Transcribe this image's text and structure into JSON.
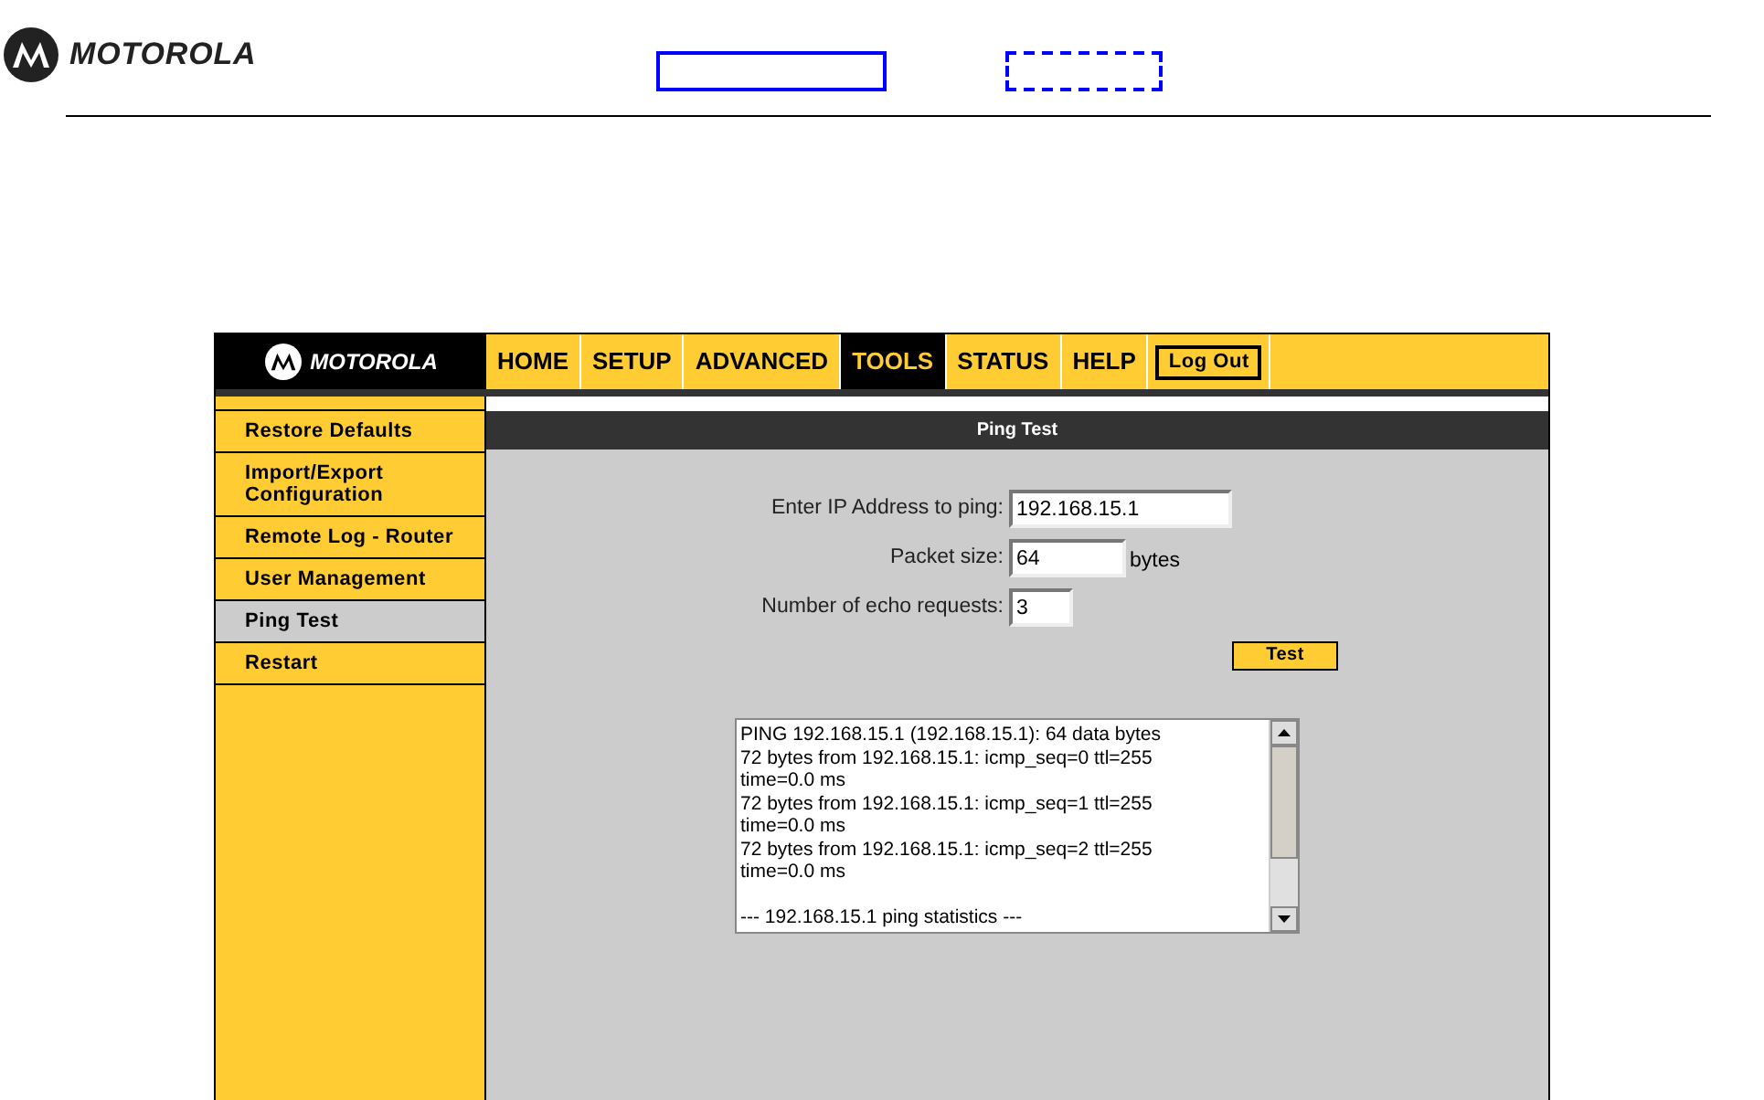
{
  "header": {
    "brand": "MOTOROLA"
  },
  "router_ui": {
    "brand": "MOTOROLA",
    "nav": [
      {
        "label": "HOME",
        "selected": false
      },
      {
        "label": "SETUP",
        "selected": false
      },
      {
        "label": "ADVANCED",
        "selected": false
      },
      {
        "label": "TOOLS",
        "selected": true
      },
      {
        "label": "STATUS",
        "selected": false
      },
      {
        "label": "HELP",
        "selected": false
      }
    ],
    "logout_button": "Log Out",
    "sidebar": [
      {
        "label": "Restore Defaults",
        "selected": false
      },
      {
        "label": "Import/Export Configuration",
        "selected": false
      },
      {
        "label": "Remote Log - Router",
        "selected": false
      },
      {
        "label": "User Management",
        "selected": false
      },
      {
        "label": "Ping Test",
        "selected": true
      },
      {
        "label": "Restart",
        "selected": false
      }
    ],
    "panel_title": "Ping Test",
    "fields": [
      {
        "label": "Enter IP Address to ping:",
        "value": "192.168.15.1"
      },
      {
        "label": "Packet size:",
        "value": "64",
        "unit": "bytes"
      },
      {
        "label": "Number of echo requests:",
        "value": "3"
      }
    ],
    "test_button": "Test",
    "output": "PING 192.168.15.1 (192.168.15.1): 64 data bytes\n72 bytes from 192.168.15.1: icmp_seq=0 ttl=255\ntime=0.0 ms\n72 bytes from 192.168.15.1: icmp_seq=1 ttl=255\ntime=0.0 ms\n72 bytes from 192.168.15.1: icmp_seq=2 ttl=255\ntime=0.0 ms\n\n--- 192.168.15.1 ping statistics ---"
  }
}
